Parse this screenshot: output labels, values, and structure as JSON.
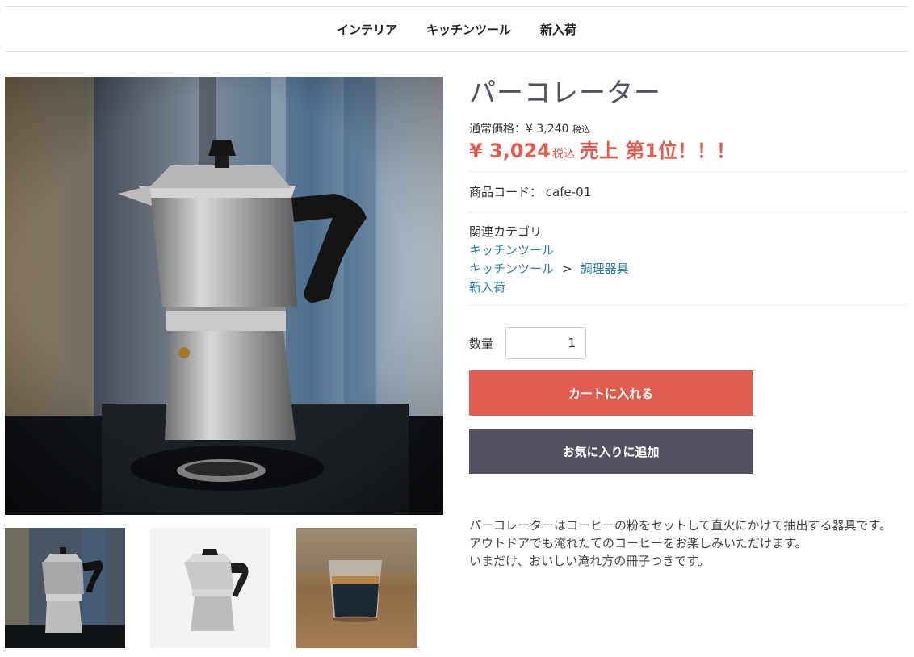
{
  "nav": {
    "items": [
      "インテリア",
      "キッチンツール",
      "新入荷"
    ]
  },
  "product": {
    "title": "パーコレーター",
    "regular_price_label": "通常価格：¥ 3,240",
    "regular_tax": "税込",
    "sale_price": "¥ 3,024",
    "sale_tax": "税込",
    "promo": "売上 第1位！！！",
    "code_label": "商品コード：",
    "code_value": "cafe-01",
    "categories_label": "関連カテゴリ",
    "categories": {
      "c1": "キッチンツール",
      "c2_parent": "キッチンツール",
      "c2_sep": ">",
      "c2_child": "調理器具",
      "c3": "新入荷"
    },
    "quantity_label": "数量",
    "quantity_value": "1",
    "add_to_cart": "カートに入れる",
    "add_to_favorites": "お気に入りに追加",
    "description": [
      "パーコレーターはコーヒーの粉をセットして直火にかけて抽出する器具です。",
      "アウトドアでも淹れたてのコーヒーをお楽しみいただけます。",
      "いまだけ、おいしい淹れ方の冊子つきです。"
    ]
  },
  "colors": {
    "accent_red": "#DE5D50",
    "dark_button": "#525263",
    "link_blue": "#2B7FA8"
  }
}
